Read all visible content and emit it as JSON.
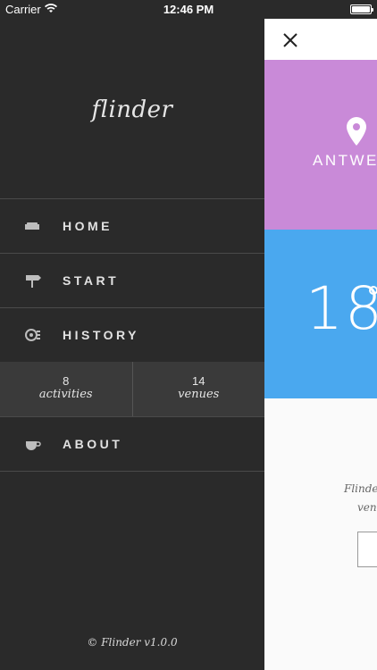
{
  "status_bar": {
    "carrier": "Carrier",
    "time": "12:46 PM"
  },
  "menu": {
    "logo": "flinder",
    "items": [
      {
        "label": "HOME",
        "icon": "sofa-icon"
      },
      {
        "label": "START",
        "icon": "signpost-icon"
      },
      {
        "label": "HISTORY",
        "icon": "history-icon"
      },
      {
        "label": "ABOUT",
        "icon": "coffee-icon"
      }
    ],
    "stats": [
      {
        "value": "8",
        "caption": "activities"
      },
      {
        "value": "14",
        "caption": "venues"
      }
    ],
    "copyright": "© Flinder v1.0.0"
  },
  "panel": {
    "city": "ANTWE",
    "temperature": "18",
    "description_line1": "Flinder",
    "description_line2": "venu",
    "colors": {
      "location_bg": "#c98ad8",
      "weather_bg": "#4aa8ef"
    }
  }
}
